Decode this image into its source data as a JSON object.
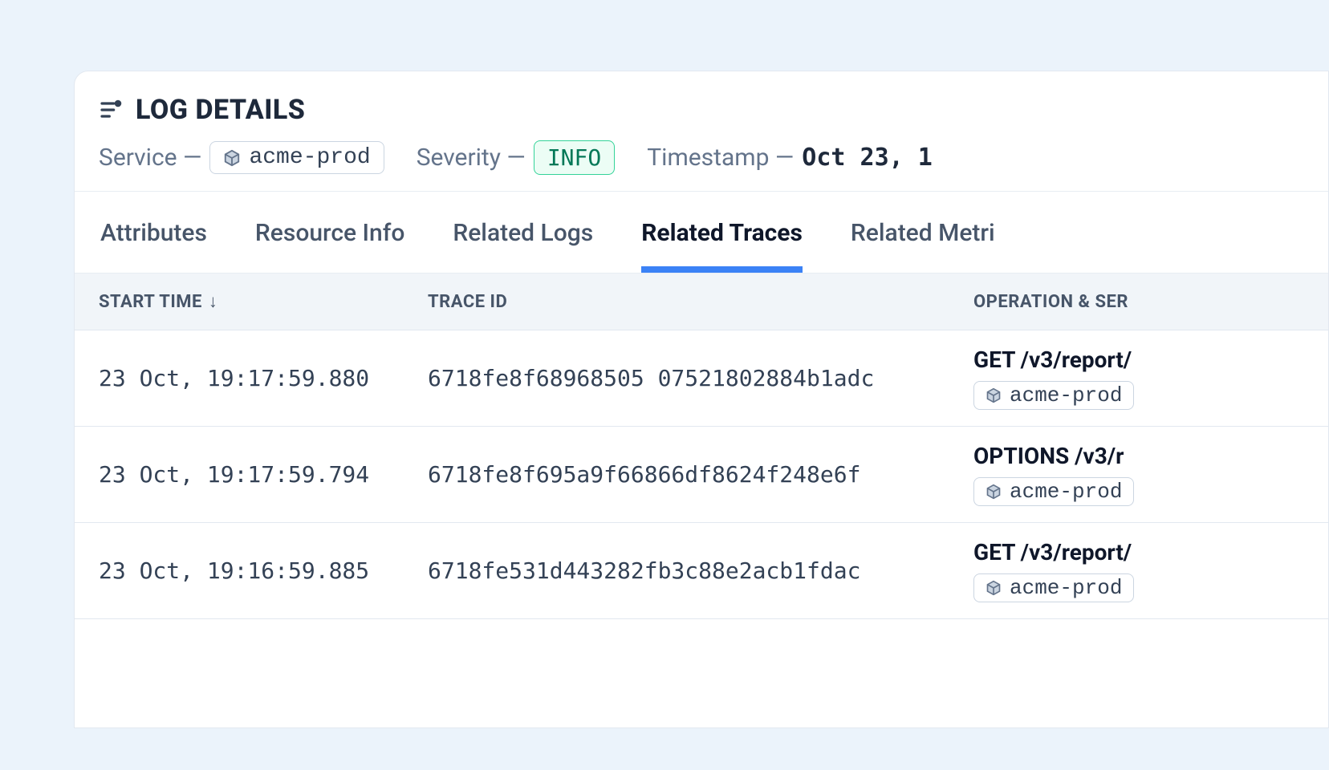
{
  "title": "LOG DETAILS",
  "meta": {
    "service_label": "Service —",
    "service_value": "acme-prod",
    "severity_label": "Severity —",
    "severity_value": "INFO",
    "timestamp_label": "Timestamp —",
    "timestamp_value": "Oct 23, 1"
  },
  "tabs": [
    {
      "label": "Attributes",
      "active": false
    },
    {
      "label": "Resource Info",
      "active": false
    },
    {
      "label": "Related Logs",
      "active": false
    },
    {
      "label": "Related Traces",
      "active": true
    },
    {
      "label": "Related Metri",
      "active": false
    }
  ],
  "columns": {
    "start_time": "START TIME",
    "trace_id": "TRACE ID",
    "op_service": "OPERATION & SER"
  },
  "rows": [
    {
      "start_time": "23 Oct, 19:17:59.880",
      "trace_id": "6718fe8f68968505 07521802884b1adc",
      "operation": "GET /v3/report/",
      "service": "acme-prod"
    },
    {
      "start_time": "23 Oct, 19:17:59.794",
      "trace_id": "6718fe8f695a9f66866df8624f248e6f",
      "operation": "OPTIONS /v3/r",
      "service": "acme-prod"
    },
    {
      "start_time": "23 Oct, 19:16:59.885",
      "trace_id": "6718fe531d443282fb3c88e2acb1fdac",
      "operation": "GET /v3/report/",
      "service": "acme-prod"
    }
  ]
}
